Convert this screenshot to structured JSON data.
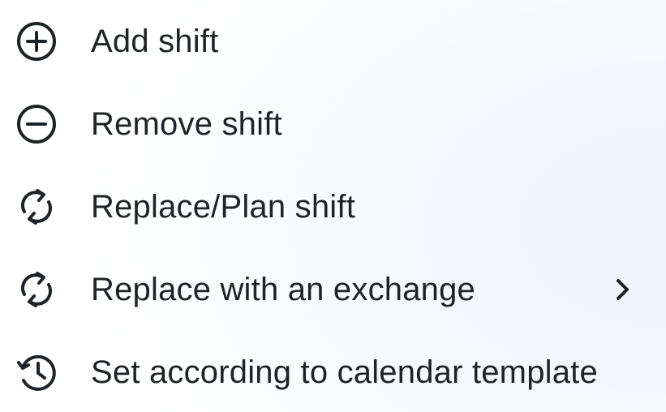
{
  "menu": {
    "items": [
      {
        "label": "Add shift",
        "icon": "plus-circle-icon"
      },
      {
        "label": "Remove shift",
        "icon": "minus-circle-icon"
      },
      {
        "label": "Replace/Plan shift",
        "icon": "refresh-icon"
      },
      {
        "label": "Replace with an exchange",
        "icon": "refresh-icon",
        "submenu_icon": "chevron-right-icon"
      },
      {
        "label": "Set according to calendar template",
        "icon": "history-icon"
      }
    ]
  },
  "colors": {
    "text": "#1f2226",
    "icon": "#1f2226",
    "background": "#ffffff"
  }
}
